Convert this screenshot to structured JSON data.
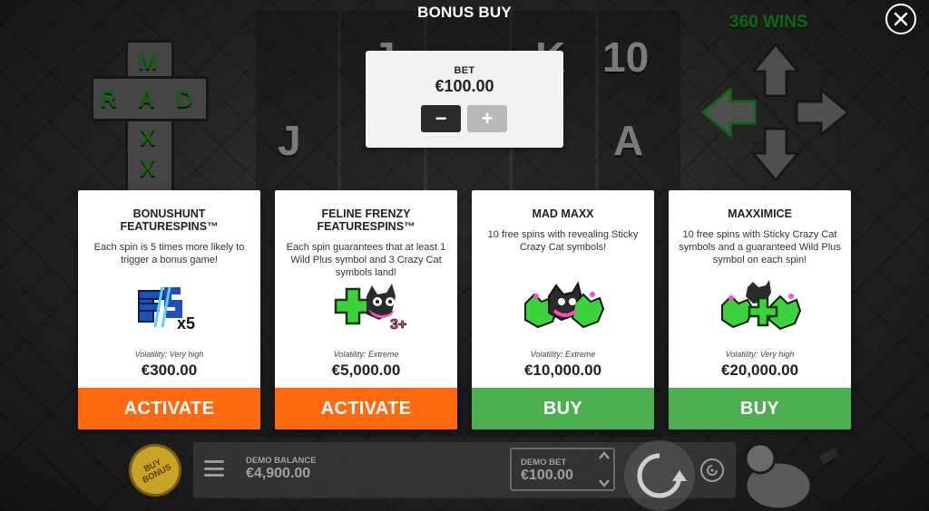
{
  "header": {
    "title": "BONUS BUY",
    "close_icon": "close-icon"
  },
  "background": {
    "logo_letters": [
      "M",
      "R",
      "A",
      "D",
      "A",
      "X",
      "X"
    ],
    "wins_text": "360 WINS",
    "reel_symbols": [
      "J",
      "K",
      "10",
      "J",
      "A"
    ]
  },
  "bet": {
    "label": "BET",
    "value": "€100.00",
    "minus_label": "−",
    "plus_label": "+"
  },
  "cards": [
    {
      "title_line1": "BONUSHUNT",
      "title_line2": "FEATURESPINS™",
      "description": "Each spin is 5 times more likely to trigger a bonus game!",
      "image": "fs-x5-icon",
      "image_badge": "x5",
      "volatility": "Volatility: Very high",
      "price": "€300.00",
      "action": "ACTIVATE",
      "action_color": "#ff6a10"
    },
    {
      "title_line1": "FELINE FRENZY",
      "title_line2": "FEATURESPINS™",
      "description": "Each spin guarantees that at least 1 Wild Plus symbol and 3 Crazy Cat symbols land!",
      "image": "wild-plus-cat-icon",
      "image_badge": "3+",
      "volatility": "Volatility: Extreme",
      "price": "€5,000.00",
      "action": "ACTIVATE",
      "action_color": "#ff6a10"
    },
    {
      "title_line1": "MAD MAXX",
      "title_line2": "",
      "description": "10 free spins with revealing Sticky Crazy Cat symbols!",
      "image": "crazy-cats-icon",
      "image_badge": "",
      "volatility": "Volatility: Extreme",
      "price": "€10,000.00",
      "action": "BUY",
      "action_color": "#4caf50"
    },
    {
      "title_line1": "MAXXIMICE",
      "title_line2": "",
      "description": "10 free spins with Sticky Crazy Cat symbols and a guaranteed Wild Plus symbol on each spin!",
      "image": "crazy-cats-wild-plus-icon",
      "image_badge": "",
      "volatility": "Volatility: Very high",
      "price": "€20,000.00",
      "action": "BUY",
      "action_color": "#4caf50"
    }
  ],
  "bottom_bar": {
    "buy_bonus_line1": "BUY",
    "buy_bonus_line2": "BONUS",
    "menu_icon": "hamburger-menu-icon",
    "balance_label": "DEMO BALANCE",
    "balance_value": "€4,900.00",
    "demo_bet_label": "DEMO BET",
    "demo_bet_value": "€100.00",
    "bet_up_icon": "chevron-up-icon",
    "bet_down_icon": "chevron-down-icon",
    "spin_icon": "spin-icon",
    "autoplay_icon": "autoplay-icon"
  }
}
